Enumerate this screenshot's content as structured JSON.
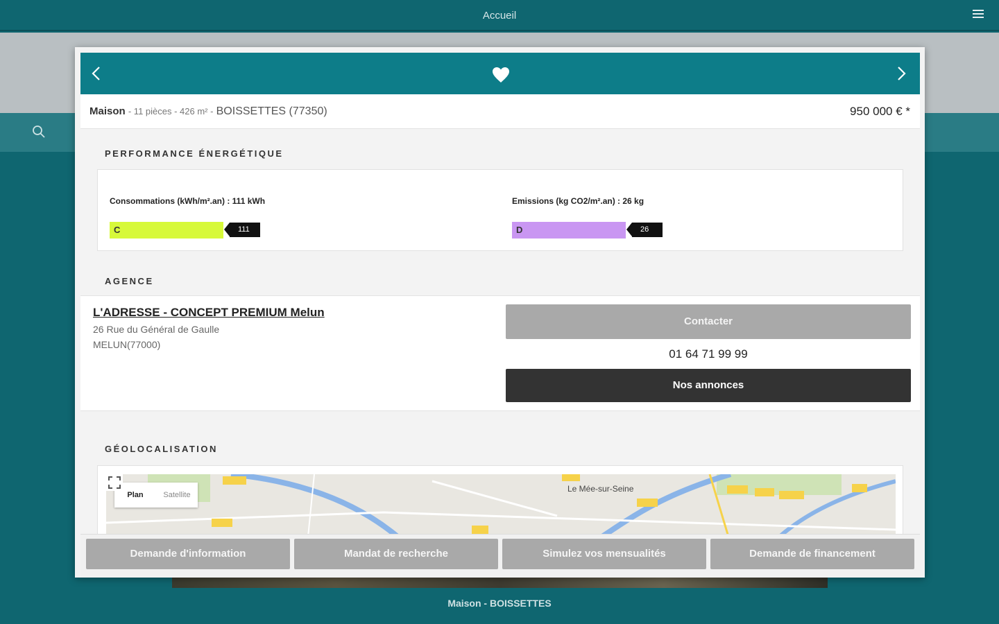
{
  "app": {
    "title": "Accueil",
    "caption": "Maison - BOISSETTES"
  },
  "summary": {
    "type": "Maison",
    "details": "- 11 pièces - 426 m² -",
    "city": "BOISSETTES (77350)",
    "price": "950 000 € *"
  },
  "energy": {
    "title": "PERFORMANCE ÉNERGÉTIQUE",
    "consumption": {
      "label": "Consommations (kWh/m².an) : 111 kWh",
      "grade": "C",
      "value": "111",
      "color": "#d7f93a"
    },
    "emissions": {
      "label": "Emissions (kg CO2/m².an) : 26 kg",
      "grade": "D",
      "value": "26",
      "color": "#c996f2"
    }
  },
  "agency": {
    "title": "AGENCE",
    "name": "L'ADRESSE - CONCEPT PREMIUM Melun",
    "street": "26 Rue du Général de Gaulle",
    "city": "MELUN(77000)",
    "contact_label": "Contacter",
    "phone": "01 64 71 99 99",
    "ads_label": "Nos annonces"
  },
  "geo": {
    "title": "GÉOLOCALISATION",
    "map_type_plan": "Plan",
    "map_type_satellite": "Satellite",
    "town_label": "Le Mée-sur-Seine"
  },
  "actions": {
    "info": "Demande d'information",
    "mandate": "Mandat de recherche",
    "simulate": "Simulez vos mensualités",
    "financing": "Demande de financement"
  },
  "colors": {
    "brand": "#0d7d89",
    "background": "#0f6670"
  }
}
